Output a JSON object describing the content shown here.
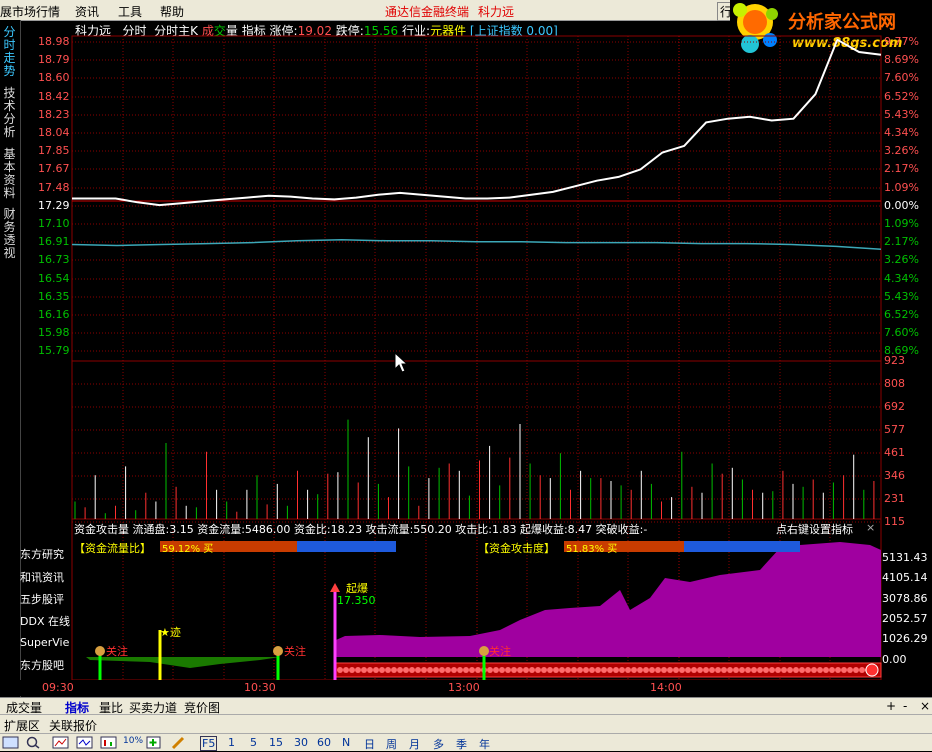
{
  "menubar": {
    "item1": "展市场行情",
    "item2": "资讯",
    "item3": "工具",
    "item4": "帮助",
    "title": "通达信金融终端",
    "stock": "科力远",
    "right_btn": "行"
  },
  "logo": {
    "brand": "分析家公式网",
    "url": "www.88gs.com"
  },
  "side_tabs": [
    "分时走势",
    "技术分析",
    "基本资料",
    "财务透视"
  ],
  "info": {
    "name": "科力远",
    "t1": "分时",
    "t2": "分时主K",
    "t3a": "成",
    "t3b": "交",
    "t3c": "量",
    "t4": "指标",
    "zt_label": "涨停:",
    "zt_val": "19.02",
    "dt_label": "跌停:",
    "dt_val": "15.56",
    "ind_label": "行业:",
    "ind_val": "元器件",
    "ref": "[上证指数 0.00]"
  },
  "price_axis": [
    "18.98",
    "18.79",
    "18.60",
    "18.42",
    "18.23",
    "18.04",
    "17.85",
    "17.67",
    "17.48",
    "17.29",
    "17.10",
    "16.91",
    "16.73",
    "16.54",
    "16.35",
    "16.16",
    "15.98",
    "15.79"
  ],
  "pct_axis": [
    "9.77%",
    "8.69%",
    "7.60%",
    "6.52%",
    "5.43%",
    "4.34%",
    "3.26%",
    "2.17%",
    "1.09%",
    "0.00%",
    "1.09%",
    "2.17%",
    "3.26%",
    "4.34%",
    "5.43%",
    "6.52%",
    "7.60%",
    "8.69%"
  ],
  "vol_axis": [
    "923",
    "808",
    "692",
    "577",
    "461",
    "346",
    "231",
    "115"
  ],
  "ind_bar": {
    "text": "资金攻击量  流通盘:3.15  资金流量:5486.00  资金比:18.23  攻击流量:550.20  攻击比:1.83  起爆收益:8.47  突破收益:-",
    "right": "点右键设置指标",
    "close": "×"
  },
  "badge1": {
    "label": "【资金流量比】",
    "val": "59.12% 买"
  },
  "badge2": {
    "label": "【资金攻击度】",
    "val": "51.83% 买"
  },
  "ind_axis": [
    "5131.43",
    "4105.14",
    "3078.86",
    "2052.57",
    "1026.29",
    "0.00"
  ],
  "left_labels": [
    "东方研究",
    "和讯资讯",
    "五步股评",
    "DDX 在线",
    "SuperVie",
    "东方股吧"
  ],
  "markers": {
    "m1": "关注",
    "m2": "★迹",
    "m3": "关注",
    "m4": "起爆",
    "m5": "17.350",
    "m6": "关注"
  },
  "time_axis": [
    "09:30",
    "10:30",
    "13:00",
    "14:00"
  ],
  "tabs": [
    "成交量",
    "指标",
    "量比",
    "买卖力道",
    "竞价图"
  ],
  "tab_buttons": [
    "+",
    "-",
    "×"
  ],
  "bottom1": [
    "扩展区",
    "关联报价"
  ],
  "bottom2": [
    "F5",
    "1",
    "5",
    "15",
    "30",
    "60",
    "N",
    "日",
    "周",
    "月",
    "多",
    "季",
    "年"
  ],
  "zoom": "10%",
  "chart_data": {
    "type": "line",
    "series": [
      {
        "values": [
          17.29,
          17.29,
          17.29,
          17.25,
          17.22,
          17.24,
          17.26,
          17.28,
          17.3,
          17.32,
          17.31,
          17.29,
          17.28,
          17.3,
          17.33,
          17.35,
          17.33,
          17.31,
          17.29,
          17.29,
          17.3,
          17.33,
          17.36,
          17.42,
          17.48,
          17.52,
          17.6,
          17.78,
          17.85,
          18.1,
          18.14,
          18.16,
          18.12,
          18.14,
          18.4,
          18.98,
          18.85,
          18.82
        ]
      },
      {
        "values": [
          16.8,
          16.79,
          16.8,
          16.81,
          16.82,
          16.84,
          16.85,
          16.84,
          16.84,
          16.83,
          16.83,
          16.82,
          16.82,
          16.82,
          16.81,
          16.81,
          16.8,
          16.78,
          16.75
        ]
      }
    ],
    "ylim": [
      15.56,
      19.02
    ],
    "volume": {
      "values": [
        120,
        80,
        300,
        40,
        90,
        360,
        60,
        180,
        120,
        520,
        220,
        90,
        80,
        460,
        200,
        120,
        50,
        200,
        300,
        100,
        240,
        90,
        330,
        200,
        170,
        310,
        320,
        680,
        250,
        560,
        240,
        150,
        620,
        360,
        90,
        280,
        350,
        380,
        330,
        160,
        400,
        500,
        230,
        420,
        650,
        380,
        300,
        280,
        450,
        200,
        330,
        280,
        280,
        260,
        230,
        200,
        330,
        240,
        120,
        150,
        460,
        220,
        180,
        380,
        310,
        350,
        270,
        200,
        180,
        190,
        330,
        240,
        220,
        270,
        180,
        250,
        300,
        440,
        200,
        260
      ],
      "ylim": [
        0,
        1040
      ]
    },
    "indicator": {
      "ylim": [
        0,
        5131.43
      ]
    }
  }
}
